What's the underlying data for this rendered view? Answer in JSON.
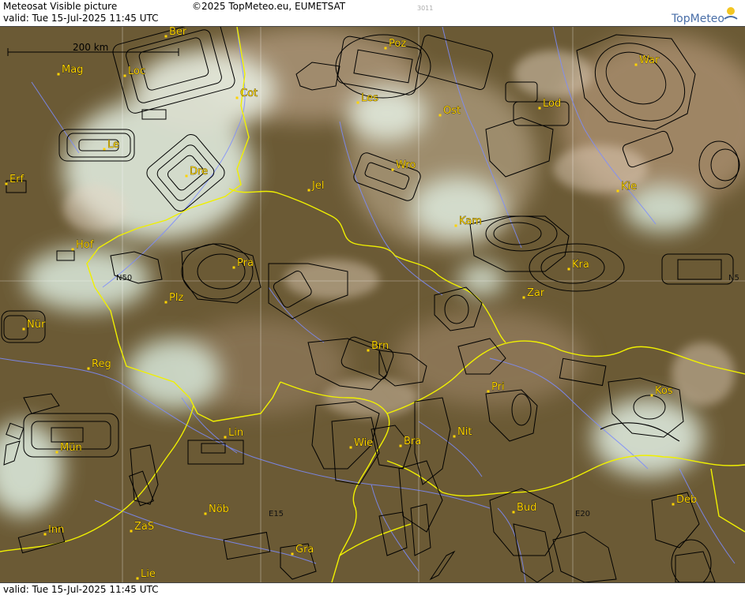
{
  "header": {
    "title": "Meteosat Visible picture",
    "valid": "valid:  Tue  15-Jul-2025  11:45 UTC",
    "copyright": "©2025 TopMeteo.eu, EUMETSAT",
    "image_code": "3011",
    "brand": "TopMeteo"
  },
  "footer": {
    "valid": "valid:  Tue  15-Jul-2025  11:45 UTC"
  },
  "scale": {
    "label": "200 km"
  },
  "grid_labels": [
    "N50",
    "N5",
    "E15",
    "E20"
  ],
  "cities": [
    "Ber",
    "Poz",
    "War",
    "Mag",
    "Loc",
    "Cot",
    "Les",
    "Ost",
    "Lod",
    "Le",
    "Dre",
    "Wro",
    "Erf",
    "Jel",
    "Kie",
    "Kam",
    "Hof",
    "Pra",
    "Kra",
    "Plz",
    "Zar",
    "Nür",
    "Brn",
    "Reg",
    "Pri",
    "Kos",
    "Lin",
    "Nit",
    "Wie",
    "Bra",
    "Mün",
    "Nöb",
    "Bud",
    "Deb",
    "Inn",
    "ZaS",
    "Gra",
    "Lie"
  ],
  "colors": {
    "ground": "#6b5a35",
    "cloud": "#dfe9dc",
    "label": "#ffd400",
    "border": "#f0f000",
    "river": "#7c8cff",
    "airspace": "#000000",
    "brand": "#4a6fa8"
  }
}
